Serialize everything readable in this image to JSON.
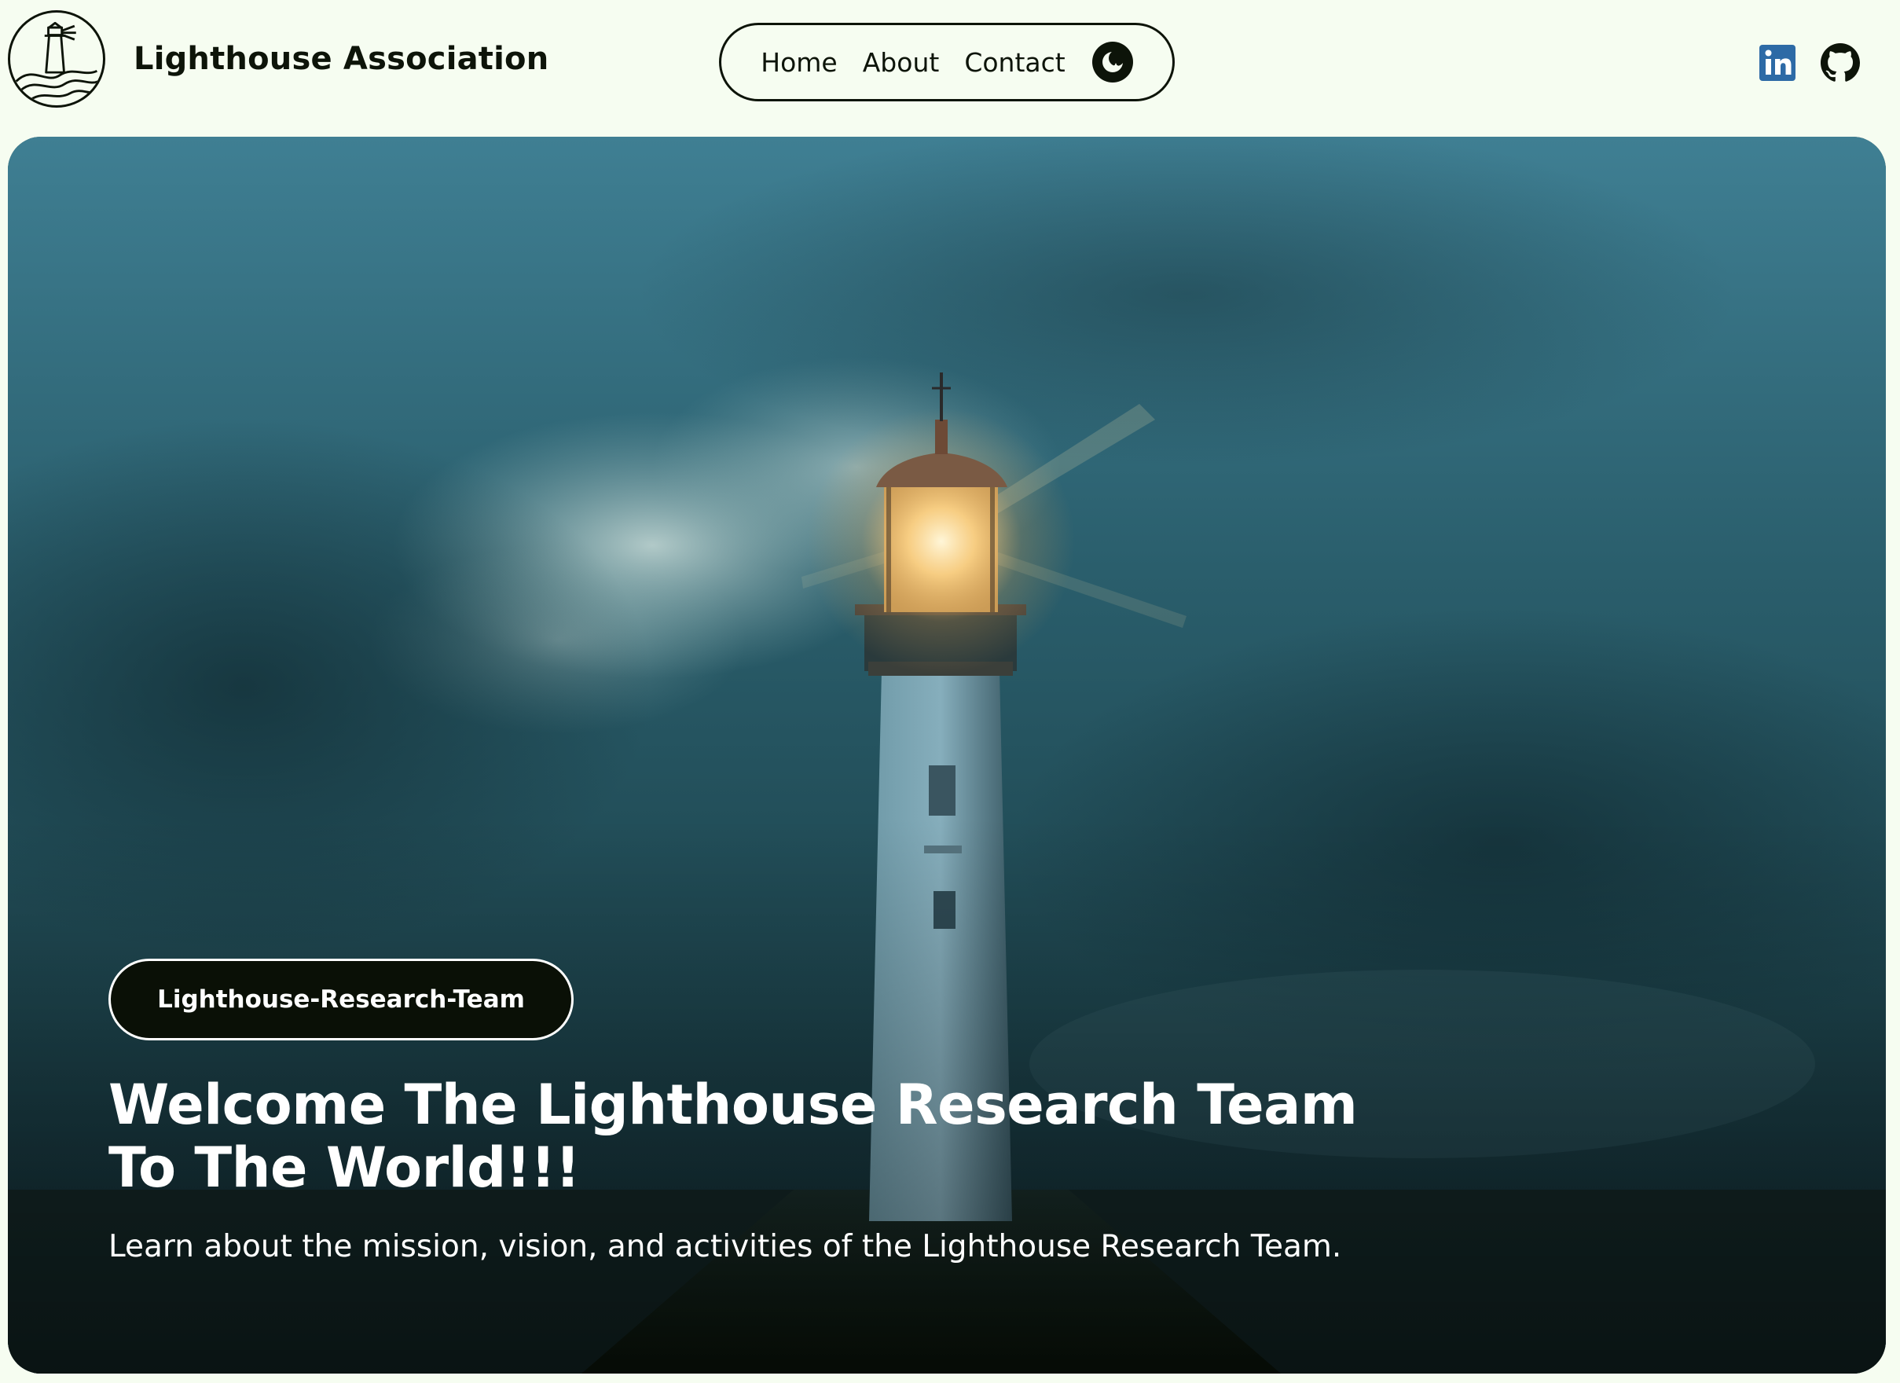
{
  "header": {
    "brand": "Lighthouse Association",
    "nav": [
      {
        "label": "Home"
      },
      {
        "label": "About"
      },
      {
        "label": "Contact"
      }
    ],
    "theme_toggle_icon": "moon-icon",
    "social": [
      {
        "icon": "linkedin-icon",
        "color": "#2d6aa6"
      },
      {
        "icon": "github-icon",
        "color": "#0d1409"
      }
    ]
  },
  "hero": {
    "badge": "Lighthouse-Research-Team",
    "title": "Welcome The Lighthouse Research Team To The World!!!",
    "subtitle": "Learn about the mission, vision, and activities of the Lighthouse Research Team.",
    "image": "lighthouse-at-dusk"
  },
  "colors": {
    "page_bg": "#f6fdf1",
    "text": "#0d1409",
    "badge_bg": "#0a1006",
    "hero_overlay": "#0f2a30"
  }
}
